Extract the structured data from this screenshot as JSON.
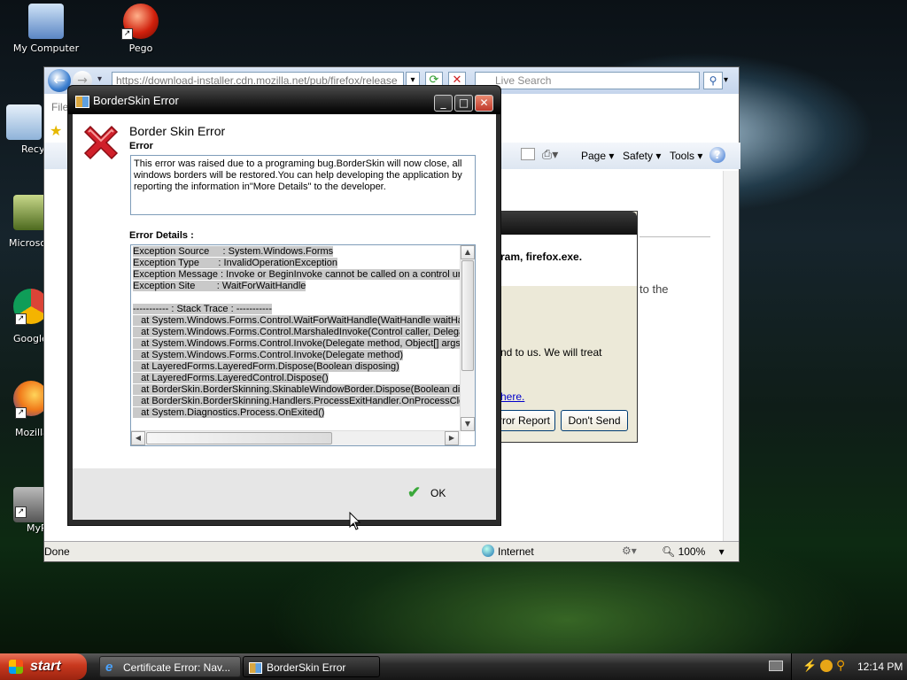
{
  "desktop": {
    "icons": [
      {
        "label": "My Computer"
      },
      {
        "label": "Pego"
      },
      {
        "label": "Recy"
      },
      {
        "label": "Microsof"
      },
      {
        "label": "Google"
      },
      {
        "label": "Mozilla"
      },
      {
        "label": "MyP"
      }
    ]
  },
  "browser": {
    "address": "https://download-installer.cdn.mozilla.net/pub/firefox/release",
    "search_placeholder": "Live Search",
    "menu_fragment": "File",
    "command_bar": {
      "page": "Page",
      "safety": "Safety",
      "tools": "Tools"
    },
    "status": {
      "text": "Done",
      "zone": "Internet",
      "zoom": "100%"
    },
    "behind_text": {
      "to_the": "to the",
      "program": "ram, firefox.exe.",
      "send_text": "nd to us.  We will treat",
      "link": "here."
    },
    "behind_buttons": {
      "send": "rror Report",
      "dont_send": "Don't Send"
    }
  },
  "dialog": {
    "title": "BorderSkin Error",
    "heading": "Border Skin Error",
    "error_label": "Error",
    "error_message": "This error was raised due to a programing bug.BorderSkin will now close, all windows borders will be restored.You can help developing the application by reporting the information in\"More Details\" to the developer.",
    "details_label": "Error Details :",
    "details_lines": [
      "Exception Source     : System.Windows.Forms",
      "Exception Type       : InvalidOperationException",
      "Exception Message : Invoke or BeginInvoke cannot be called on a control until",
      "Exception Site        : WaitForWaitHandle",
      "",
      "----------- : Stack Trace : -----------",
      "   at System.Windows.Forms.Control.WaitForWaitHandle(WaitHandle waitHand",
      "   at System.Windows.Forms.Control.MarshaledInvoke(Control caller, Delegate",
      "   at System.Windows.Forms.Control.Invoke(Delegate method, Object[] args)",
      "   at System.Windows.Forms.Control.Invoke(Delegate method)",
      "   at LayeredForms.LayeredForm.Dispose(Boolean disposing)",
      "   at LayeredForms.LayeredControl.Dispose()",
      "   at BorderSkin.BorderSkinning.SkinableWindowBorder.Dispose(Boolean disp",
      "   at BorderSkin.BorderSkinning.Handlers.ProcessExitHandler.OnProcessClose",
      "   at System.Diagnostics.Process.OnExited()"
    ],
    "ok_label": "OK"
  },
  "taskbar": {
    "start_label": "start",
    "tasks": [
      {
        "label": "Certificate Error: Nav..."
      },
      {
        "label": "BorderSkin Error"
      }
    ],
    "clock": "12:14 PM"
  },
  "colors": {
    "dialog_title": "#1c1c1c",
    "error_icon": "#d0202a",
    "ok_check": "#3aa83a",
    "start_button": "#c8381e"
  }
}
